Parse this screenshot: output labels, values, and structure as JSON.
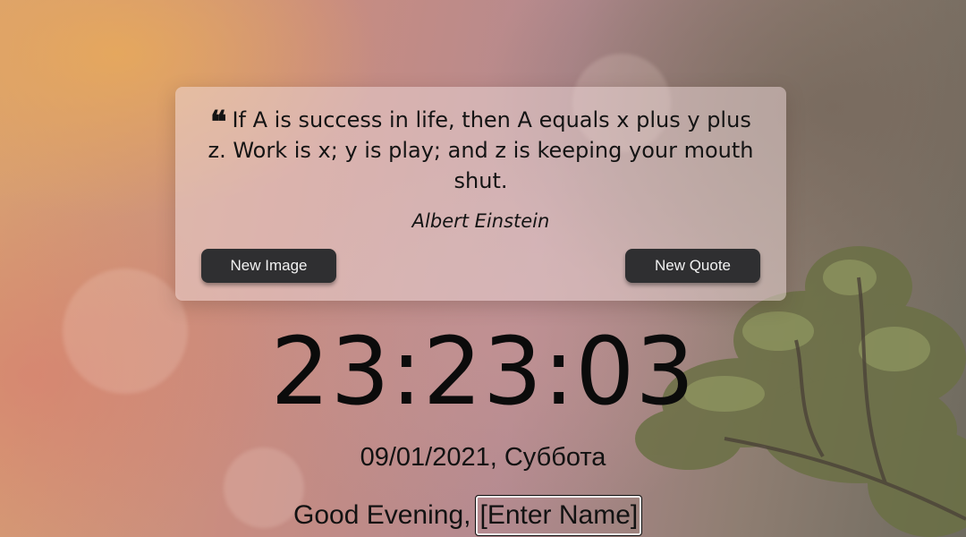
{
  "quote": {
    "text": "If A is success in life, then A equals x plus y plus z. Work is x; y is play; and z is keeping your mouth shut.",
    "author": "Albert Einstein",
    "icon": "quote-left-icon"
  },
  "buttons": {
    "new_image": "New Image",
    "new_quote": "New Quote"
  },
  "clock": {
    "time": "23:23:03",
    "date": "09/01/2021, Суббота"
  },
  "greeting": {
    "text": "Good Evening,",
    "name": "[Enter Name]"
  }
}
